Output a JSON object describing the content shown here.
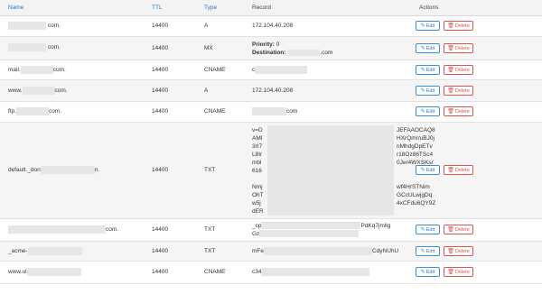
{
  "headers": {
    "name": "Name",
    "ttl": "TTL",
    "type": "Type",
    "record": "Record",
    "actions": "Actions"
  },
  "buttons": {
    "edit": "Edit",
    "delete": "Delete"
  },
  "rows": [
    {
      "name_suffix": "com.",
      "ttl": "14400",
      "type": "A",
      "record": "172.104.40.208"
    },
    {
      "name_suffix": "com.",
      "ttl": "14400",
      "type": "MX",
      "priority_label": "Priority:",
      "priority_value": "0",
      "destination_label": "Destination:",
      "destination_suffix": ".com"
    },
    {
      "name_prefix": "mail.",
      "name_suffix": "com.",
      "ttl": "14400",
      "type": "CNAME",
      "record_prefix": "c"
    },
    {
      "name_prefix": "www.",
      "name_suffix": "com.",
      "ttl": "14400",
      "type": "A",
      "record": "172.104.40.208"
    },
    {
      "name_prefix": "ftp.",
      "name_suffix": "com.",
      "ttl": "14400",
      "type": "CNAME",
      "record_suffix": "com"
    },
    {
      "name_prefix": "default._don",
      "name_suffix": "n.",
      "ttl": "14400",
      "type": "TXT",
      "record_lines": [
        {
          "left": "v=D",
          "right": "JEFAAOCAQ8"
        },
        {
          "left": "AMI",
          "right": "HXrQmr/uBJ0j"
        },
        {
          "left": "3rI7",
          "right": "nMhdgDpETv"
        },
        {
          "left": "L8Ir",
          "right": "r18Oz86TSc4"
        },
        {
          "left": "mbl",
          "right": "0Jer4WXSKs/"
        },
        {
          "left": "616",
          "right": ""
        },
        {
          "left": "",
          "right": ""
        },
        {
          "left": "Nmj",
          "right": "wf4HrSTNim"
        },
        {
          "left": "OhT",
          "right": "GCcULwjgDq"
        },
        {
          "left": "w5j",
          "right": "4xCFdu6QY9Z"
        },
        {
          "left": "dER",
          "right": ""
        }
      ]
    },
    {
      "name_suffix": "com.",
      "ttl": "14400",
      "type": "TXT",
      "record_top_left": "_cp",
      "record_top_right": "PdKq7jmllg",
      "record_bottom_left": "Gz"
    },
    {
      "name_prefix": "_acme-",
      "ttl": "14400",
      "type": "TXT",
      "record_prefix": "mFe",
      "record_suffix": "CdyNUhU"
    },
    {
      "name_prefix": "www.ul",
      "ttl": "14400",
      "type": "CNAME",
      "record_prefix": "c34"
    }
  ],
  "colors": {
    "link": "#2a79c2",
    "edit_border": "#3b8fd1",
    "delete": "#d9534f",
    "header_bg": "#f3f3f3",
    "alt_row_bg": "#f5f5f5"
  },
  "icons": {
    "edit": "pencil-icon",
    "delete": "trash-icon"
  }
}
